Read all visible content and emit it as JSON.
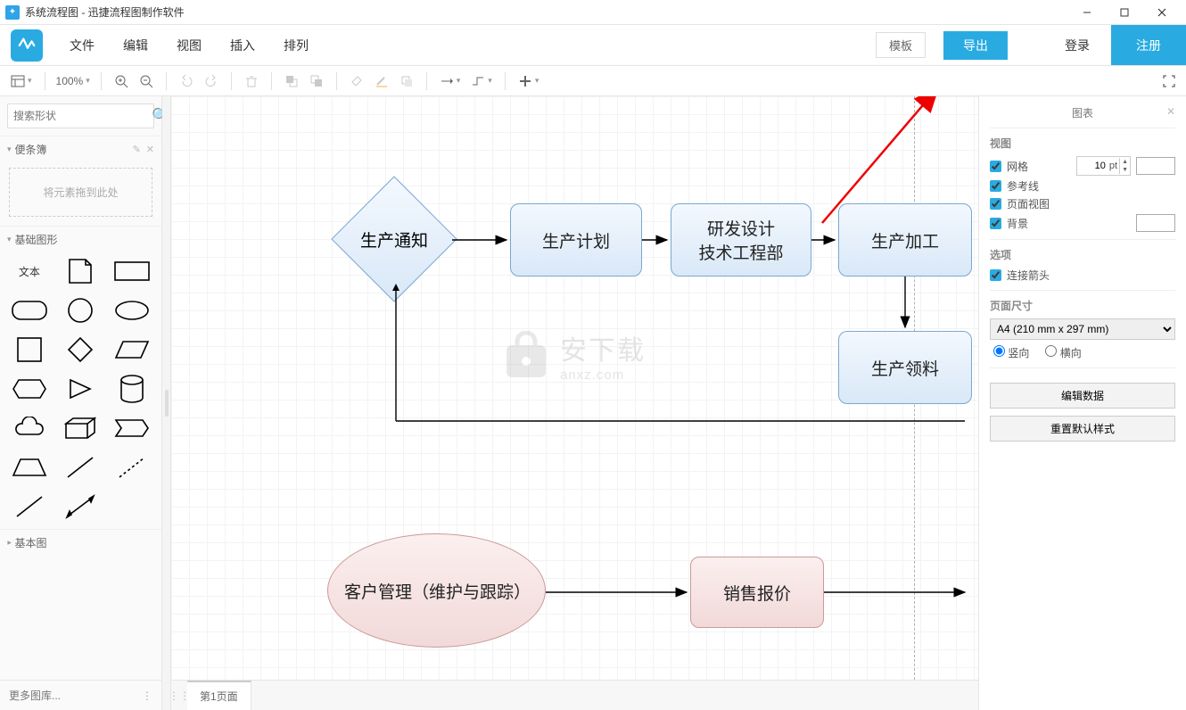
{
  "app": {
    "title": "系统流程图 - 迅捷流程图制作软件"
  },
  "menu": {
    "file": "文件",
    "edit": "编辑",
    "view": "视图",
    "insert": "插入",
    "arrange": "排列"
  },
  "actions": {
    "template": "模板",
    "export": "导出",
    "login": "登录",
    "register": "注册"
  },
  "toolbar": {
    "zoom": "100%"
  },
  "left": {
    "search_placeholder": "搜索形状",
    "scratchpad": "便条簿",
    "drop_hint": "将元素拖到此处",
    "basic_shapes": "基础图形",
    "text_shape": "文本",
    "basic_diagram": "基本图",
    "more_shapes": "更多图库..."
  },
  "nodes": {
    "n1": "生产通知",
    "n2": "生产计划",
    "n3": "研发设计\n技术工程部",
    "n4": "生产加工",
    "n5": "生产领料",
    "n6": "客户管理（维护与跟踪）",
    "n7": "销售报价"
  },
  "watermark": {
    "cn": "安下载",
    "en": "anxz.com"
  },
  "pages": {
    "p1": "第1页面"
  },
  "right": {
    "panel": "图表",
    "view": "视图",
    "grid": "网格",
    "grid_size": "10",
    "grid_unit": "pt",
    "guides": "参考线",
    "page_view": "页面视图",
    "background": "背景",
    "options": "选项",
    "conn_arrows": "连接箭头",
    "page_size": "页面尺寸",
    "page_size_value": "A4 (210 mm x 297 mm)",
    "portrait": "竖向",
    "landscape": "横向",
    "edit_data": "编辑数据",
    "reset_style": "重置默认样式"
  }
}
